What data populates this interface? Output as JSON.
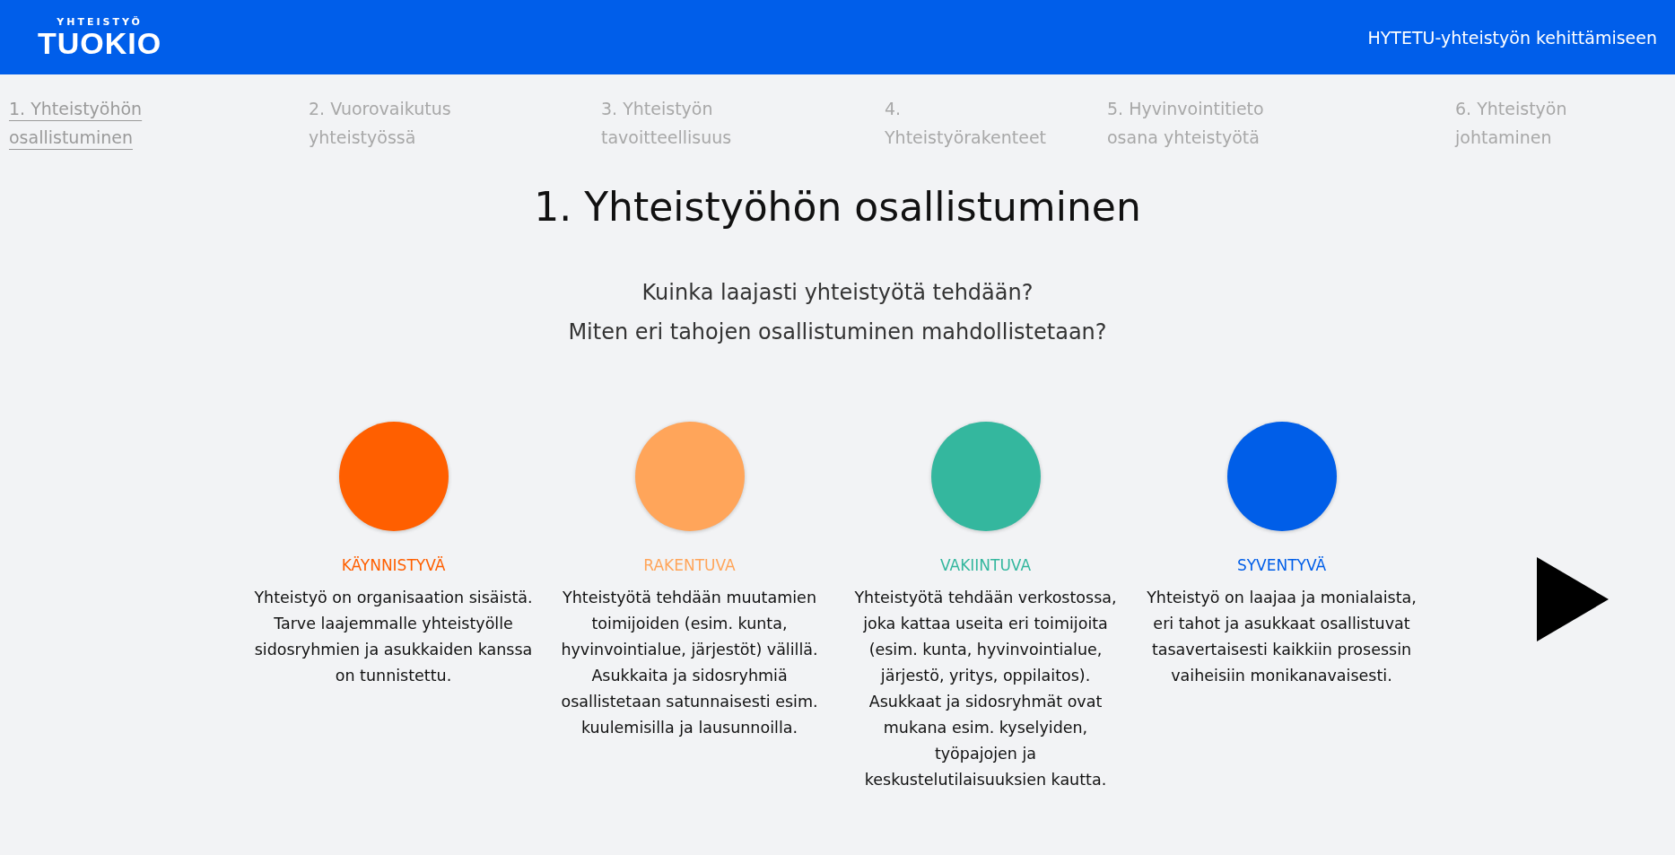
{
  "header": {
    "logo_small": "YHTEISTYÖ",
    "logo_big": "TUOKIO",
    "title": "HYTETU-yhteistyön kehittämiseen"
  },
  "nav": [
    {
      "label": "1. Yhteistyöhön osallistuminen",
      "selected": true
    },
    {
      "label": "2. Vuorovaikutus yhteistyössä",
      "selected": false
    },
    {
      "label": "3. Yhteistyön tavoitteellisuus",
      "selected": false
    },
    {
      "label": "4. Yhteistyörakenteet",
      "selected": false
    },
    {
      "label": "5. Hyvinvointitieto osana yhteistyötä",
      "selected": false
    },
    {
      "label": "6. Yhteistyön johtaminen",
      "selected": false
    }
  ],
  "heading": "1. Yhteistyöhön osallistuminen",
  "questions": [
    "Kuinka laajasti yhteistyötä tehdään?",
    "Miten eri tahojen osallistuminen mahdollistetaan?"
  ],
  "levels": [
    {
      "name": "KÄYNNISTYVÄ",
      "color": "#ff5f00",
      "description": "Yhteistyö on organisaation sisäistä. Tarve laajemmalle yhteistyölle sidosryhmien ja asukkaiden kanssa on tunnistettu."
    },
    {
      "name": "RAKENTUVA",
      "color": "#ffa55a",
      "description": "Yhteistyötä tehdään muutamien toimijoiden (esim. kunta, hyvinvointialue, järjestöt) välillä. Asukkaita ja sidosryhmiä osallistetaan satunnaisesti esim. kuulemisilla ja lausunnoilla."
    },
    {
      "name": "VAKIINTUVA",
      "color": "#34b79e",
      "description": "Yhteistyötä tehdään verkostossa, joka kattaa useita eri toimijoita (esim. kunta, hyvinvointialue, järjestö, yritys, oppilaitos). Asukkaat ja sidosryhmät ovat mukana esim. kyselyiden, työpajojen ja keskustelutilaisuuksien kautta."
    },
    {
      "name": "SYVENTYVÄ",
      "color": "#005ee8",
      "description": "Yhteistyö on laajaa ja monialaista, eri tahot ja asukkaat osallistuvat tasavertaisesti kaikkiin prosessin vaiheisiin monikanavaisesti."
    }
  ]
}
